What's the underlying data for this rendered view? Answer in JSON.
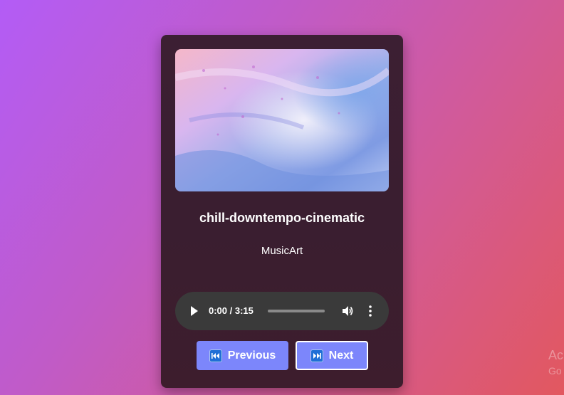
{
  "track": {
    "title": "chill-downtempo-cinematic",
    "artist": "MusicArt"
  },
  "player": {
    "time_display": "0:00 / 3:15",
    "progress_fraction": 0
  },
  "controls": {
    "previous_label": "Previous",
    "next_label": "Next"
  },
  "watermark": {
    "line1": "Ac",
    "line2": "Go"
  },
  "colors": {
    "accent_button": "#7c86fb",
    "card_background": "#3c1f33",
    "player_background": "#3a3a3a"
  },
  "icons": {
    "cover_art": "abstract-painting-image",
    "play": "play-icon",
    "volume": "volume-icon",
    "more": "more-vertical-icon",
    "previous": "skip-back-icon",
    "next": "skip-forward-icon"
  }
}
